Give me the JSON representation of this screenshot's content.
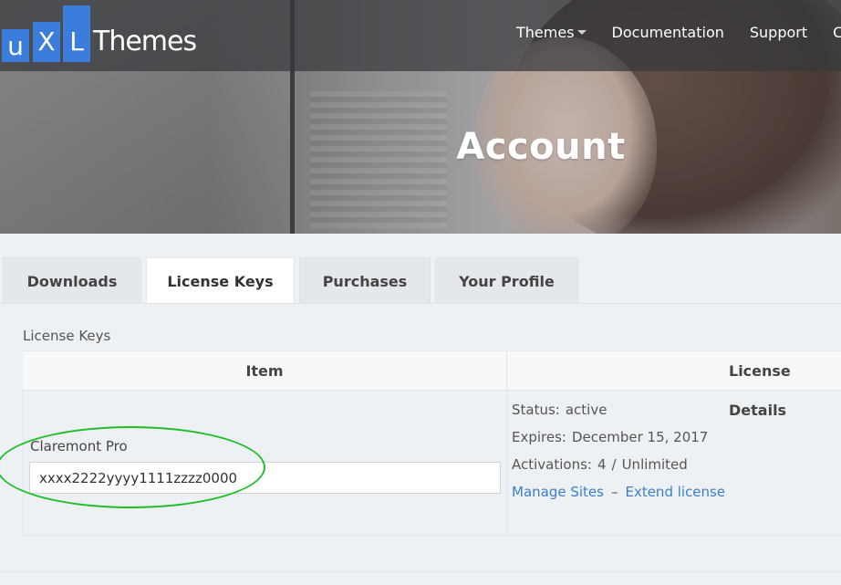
{
  "brand": {
    "blocks": [
      "u",
      "X",
      "L"
    ],
    "word": "Themes",
    "color": "#3b7ddd"
  },
  "nav": {
    "items": [
      {
        "label": "Themes",
        "has_dropdown": true
      },
      {
        "label": "Documentation"
      },
      {
        "label": "Support"
      },
      {
        "label": "Co"
      }
    ]
  },
  "hero": {
    "title": "Account"
  },
  "tabs": [
    {
      "label": "Downloads",
      "active": false
    },
    {
      "label": "License Keys",
      "active": true
    },
    {
      "label": "Purchases",
      "active": false
    },
    {
      "label": "Your Profile",
      "active": false
    }
  ],
  "license_section": {
    "label": "License Keys",
    "columns": [
      "Item",
      "License Details"
    ],
    "row": {
      "item_name": "Claremont Pro",
      "license_key": "xxxx2222yyyy1111zzzz0000",
      "status_label": "Status:",
      "status_value": "active",
      "expires_label": "Expires:",
      "expires_value": "December 15, 2017",
      "activations_label": "Activations:",
      "activations_used": "4",
      "activations_sep": "/",
      "activations_limit": "Unlimited",
      "manage_sites_link": "Manage Sites",
      "link_separator": "–",
      "extend_license_link": "Extend license"
    }
  },
  "colors": {
    "link": "#3a7fc7",
    "highlight": "#1fbf2a",
    "page_bg": "#eef1f4"
  }
}
